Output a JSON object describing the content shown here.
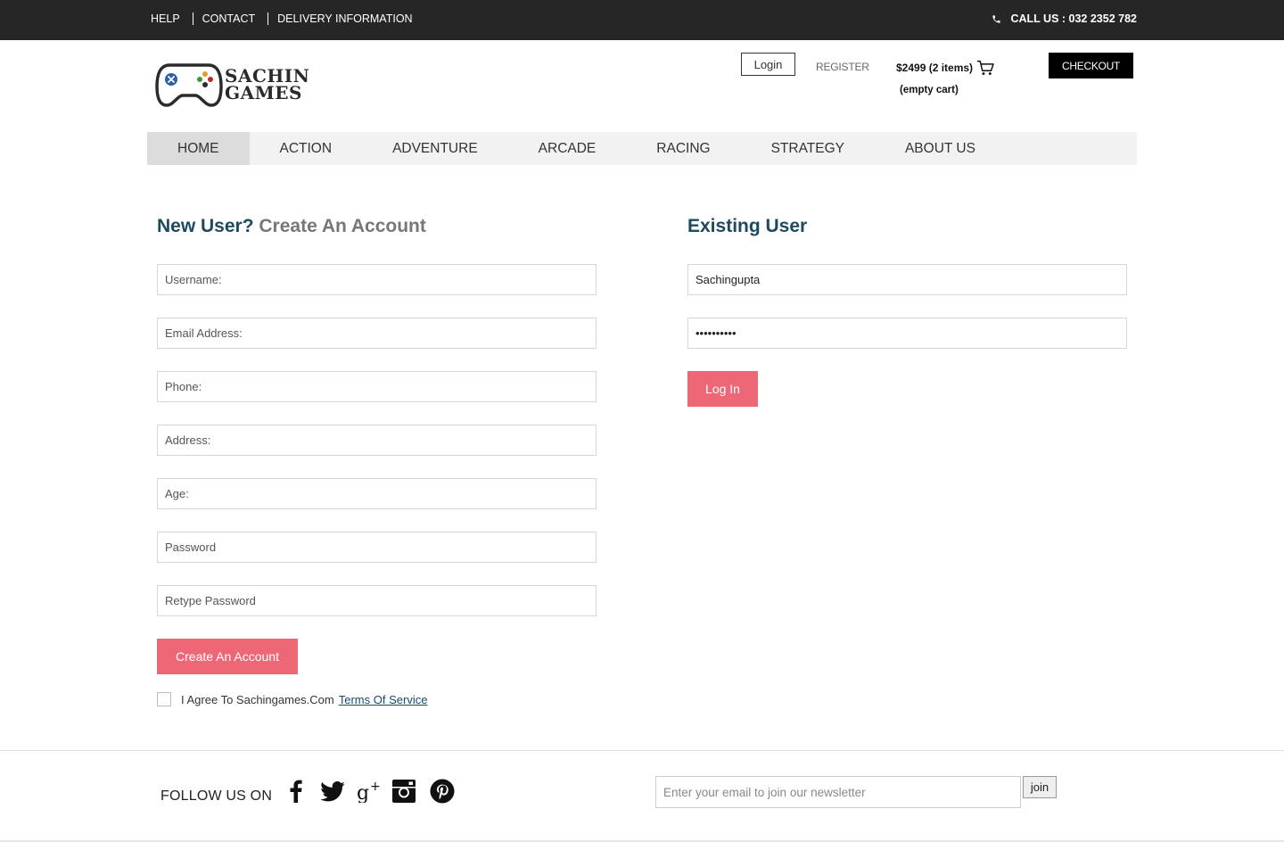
{
  "topbar": {
    "links": [
      "HELP",
      "CONTACT",
      "DELIVERY INFORMATION"
    ],
    "phone_icon": "phone-icon",
    "phone_text": "CALL US : 032 2352 782"
  },
  "header": {
    "logo_line1": "SACHIN",
    "logo_line2": "GAMES",
    "logo_icon": "gamepad-icon",
    "login_label": "Login",
    "register_label": "REGISTER",
    "cart_summary": "$2499 (2 items)",
    "cart_icon": "cart-icon",
    "cart_empty": "(empty cart)",
    "checkout_label": "CHECKOUT"
  },
  "nav": {
    "items": [
      "HOME",
      "ACTION",
      "ADVENTURE",
      "ARCADE",
      "RACING",
      "STRATEGY",
      "ABOUT US"
    ],
    "active": "HOME"
  },
  "new_user": {
    "heading_strong": "New User?",
    "heading_light": "Create An Account",
    "fields": {
      "username": "Username:",
      "email": "Email Address:",
      "phone": "Phone:",
      "address": "Address:",
      "age": "Age:",
      "password": "Password",
      "retype": "Retype Password"
    },
    "submit_label": "Create An Account",
    "agree_text": "I Agree To Sachingames.Com",
    "tos_label": "Terms Of Service"
  },
  "existing_user": {
    "heading": "Existing User",
    "username_value": "Sachingupta",
    "password_value": "••••••••••",
    "submit_label": "Log In"
  },
  "footer": {
    "follow_label": "FOLLOW US ON",
    "social_icons": [
      "facebook-icon",
      "twitter-icon",
      "google-plus-icon",
      "instagram-icon",
      "pinterest-icon"
    ],
    "newsletter_placeholder": "Enter your email to join our newsletter",
    "join_label": "join"
  },
  "colors": {
    "topbar_bg": "#262626",
    "heading_blue": "#1d4a5f",
    "accent_pink": "#ee6777",
    "nav_bg": "#f2f2f2",
    "nav_active_bg": "#dcdcdc"
  }
}
